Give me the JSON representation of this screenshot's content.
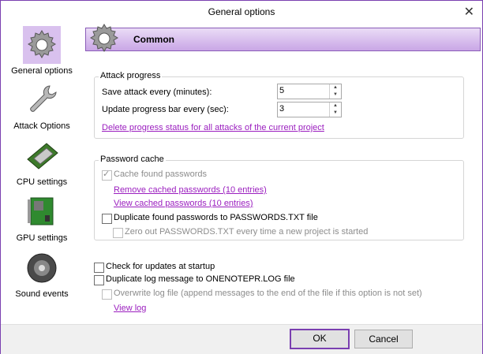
{
  "window": {
    "title": "General options"
  },
  "sidebar": {
    "items": [
      {
        "label": "General options",
        "icon": "gear-icon",
        "selected": true
      },
      {
        "label": "Attack Options",
        "icon": "wrench-icon",
        "selected": false
      },
      {
        "label": "CPU settings",
        "icon": "cpu-icon",
        "selected": false
      },
      {
        "label": "GPU settings",
        "icon": "gpu-card-icon",
        "selected": false
      },
      {
        "label": "Sound events",
        "icon": "speaker-icon",
        "selected": false
      }
    ]
  },
  "header": {
    "title": "Common",
    "icon": "gear-icon"
  },
  "attack_progress": {
    "legend": "Attack progress",
    "save_label": "Save attack every (minutes):",
    "save_value": "5",
    "update_label": "Update progress bar every (sec):",
    "update_value": "3",
    "delete_link": "Delete progress status for all attacks of the current project"
  },
  "password_cache": {
    "legend": "Password cache",
    "cache_label": "Cache found passwords",
    "cache_checked": true,
    "remove_link": "Remove cached passwords (10 entries)",
    "view_link": "View cached passwords  (10 entries)",
    "duplicate_label": "Duplicate found passwords to PASSWORDS.TXT file",
    "zero_label": "Zero out PASSWORDS.TXT every time a new project is started"
  },
  "misc": {
    "updates_label": "Check for updates at startup",
    "duplicate_log_label": "Duplicate log message to ONENOTEPR.LOG file",
    "overwrite_label": "Overwrite log file (append messages to the end of the file if this option is not set)",
    "view_log_link": "View log"
  },
  "footer": {
    "ok_label": "OK",
    "cancel_label": "Cancel"
  },
  "colors": {
    "accent": "#7a3fb0",
    "link": "#9b1fbf",
    "header_top": "#eadcf6",
    "header_bottom": "#c9a6e6"
  }
}
